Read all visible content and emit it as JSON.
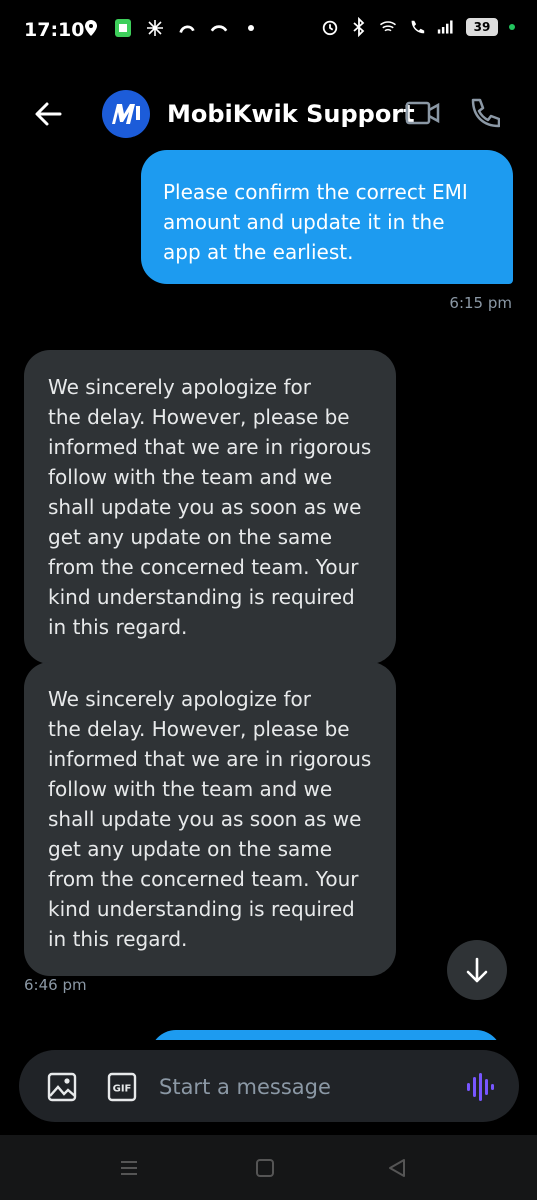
{
  "status_bar": {
    "time": "17:10",
    "battery": "39"
  },
  "header": {
    "title": "MobiKwik Support",
    "avatar_text": "M"
  },
  "messages": [
    {
      "type": "sent",
      "lines": [
        "Please confirm the correct EMI",
        "amount and update it in the",
        "app at the earliest."
      ],
      "time": "6:15 pm"
    },
    {
      "type": "received",
      "lines": [
        "We sincerely apologize for",
        "the delay. However, please be",
        "informed that we are in rigorous",
        "follow with the team and we",
        "shall update you as soon as we",
        "get any update on the same",
        "from the concerned team. Your",
        "kind understanding is required",
        "in this regard."
      ]
    },
    {
      "type": "received",
      "lines": [
        "We sincerely apologize for",
        "the delay. However, please be",
        "informed that we are in rigorous",
        "follow with the team and we",
        "shall update you as soon as we",
        "get any update on the same",
        "from the concerned team. Your",
        "kind understanding is required",
        "in this regard."
      ],
      "time": "6:46 pm"
    }
  ],
  "composer": {
    "placeholder": "Start a message",
    "gif_label": "GIF"
  },
  "colors": {
    "accent": "#1d9bf0",
    "received_bubble": "#2f3336",
    "voice": "#7856ff"
  }
}
